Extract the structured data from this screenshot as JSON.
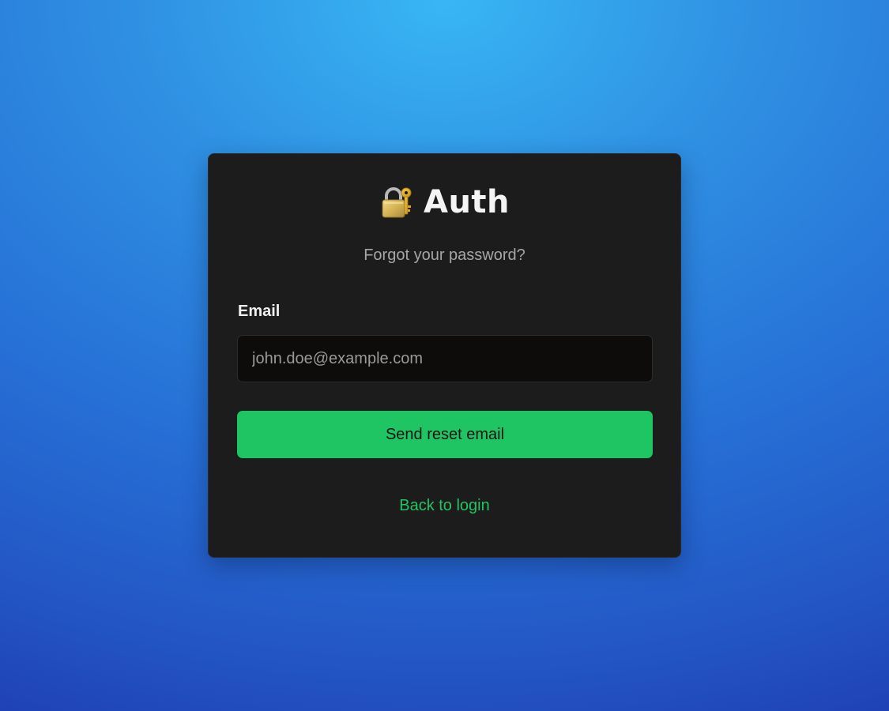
{
  "brand": {
    "icon": "locked-with-key-icon",
    "title": "Auth"
  },
  "subtitle": "Forgot your password?",
  "email": {
    "label": "Email",
    "placeholder": "john.doe@example.com",
    "value": ""
  },
  "submit_label": "Send reset email",
  "back_link_label": "Back to login",
  "colors": {
    "card_background": "#1c1c1c",
    "accent_green": "#20c563",
    "link_green": "#22c462",
    "input_background": "#0d0c0a",
    "page_gradient_top": "#38b6f4",
    "page_gradient_bottom": "#1f42b6"
  }
}
